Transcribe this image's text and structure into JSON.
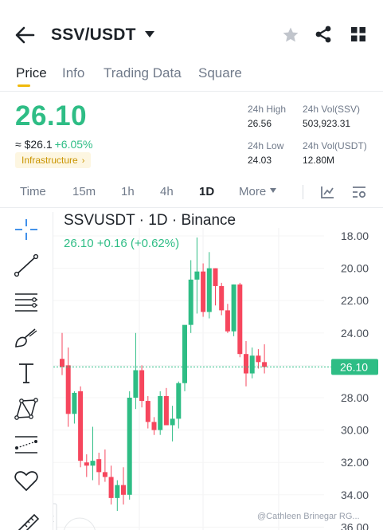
{
  "header": {
    "pair": "SSV/USDT",
    "icons": [
      "back-arrow-icon",
      "caret-down-icon",
      "star-icon",
      "share-icon",
      "grid-icon"
    ]
  },
  "tabs": [
    {
      "label": "Price",
      "active": true
    },
    {
      "label": "Info",
      "active": false
    },
    {
      "label": "Trading Data",
      "active": false
    },
    {
      "label": "Square",
      "active": false
    }
  ],
  "ticker": {
    "last_price": "26.10",
    "usd_price": "≈ $26.1",
    "change_pct": "+6.05%",
    "tag": "Infrastructure",
    "tag_chevron": "›",
    "high_label": "24h High",
    "high_value": "26.56",
    "vol_base_label": "24h Vol(SSV)",
    "vol_base_value": "503,923.31",
    "low_label": "24h Low",
    "low_value": "24.03",
    "vol_quote_label": "24h Vol(USDT)",
    "vol_quote_value": "12.80M"
  },
  "intervals": [
    {
      "label": "Time",
      "active": false
    },
    {
      "label": "15m",
      "active": false
    },
    {
      "label": "1h",
      "active": false
    },
    {
      "label": "4h",
      "active": false
    },
    {
      "label": "1D",
      "active": true
    },
    {
      "label": "More",
      "active": false
    }
  ],
  "interval_icons": [
    "indicator-chart-icon",
    "chart-settings-icon"
  ],
  "tools": [
    "crosshair-icon",
    "trend-line-icon",
    "horizontal-lines-icon",
    "brush-icon",
    "text-icon",
    "pattern-icon",
    "measure-icon",
    "heart-icon",
    "ruler-icon"
  ],
  "colors": {
    "up": "#2ebd85",
    "down": "#f6465d",
    "accent": "#f0b90b",
    "muted": "#707a8a"
  },
  "chart": {
    "title": "SSVUSDT · 1D · Binance",
    "subtitle": "26.10  +0.16 (+0.62%)",
    "price_tag": "26.10",
    "watermark": "@Cathleen Brinegar RG..."
  },
  "chart_data": {
    "type": "candlestick",
    "y_axis_ticks": [
      "18.00",
      "20.00",
      "22.00",
      "24.00",
      "26.00",
      "28.00",
      "30.00",
      "32.00",
      "34.00",
      "36.00"
    ],
    "y_inverted": true,
    "ylim": [
      17.0,
      36.5
    ],
    "last_price": 26.1,
    "candles": [
      {
        "o": 25.6,
        "h": 24.0,
        "l": 26.6,
        "c": 26.1
      },
      {
        "o": 26.0,
        "h": 24.9,
        "l": 29.8,
        "c": 29.0
      },
      {
        "o": 29.0,
        "h": 27.6,
        "l": 29.6,
        "c": 27.7
      },
      {
        "o": 27.6,
        "h": 27.3,
        "l": 32.3,
        "c": 31.9
      },
      {
        "o": 32.0,
        "h": 31.5,
        "l": 32.9,
        "c": 32.2
      },
      {
        "o": 32.2,
        "h": 29.8,
        "l": 33.1,
        "c": 31.9
      },
      {
        "o": 31.8,
        "h": 31.4,
        "l": 33.4,
        "c": 32.6
      },
      {
        "o": 32.6,
        "h": 31.2,
        "l": 33.2,
        "c": 32.9
      },
      {
        "o": 32.9,
        "h": 32.2,
        "l": 34.6,
        "c": 34.2
      },
      {
        "o": 34.2,
        "h": 33.1,
        "l": 35.0,
        "c": 33.4
      },
      {
        "o": 33.4,
        "h": 32.3,
        "l": 34.6,
        "c": 34.0
      },
      {
        "o": 34.0,
        "h": 27.6,
        "l": 34.3,
        "c": 28.0
      },
      {
        "o": 28.0,
        "h": 24.0,
        "l": 28.7,
        "c": 26.3
      },
      {
        "o": 26.3,
        "h": 26.0,
        "l": 28.6,
        "c": 28.2
      },
      {
        "o": 28.2,
        "h": 27.9,
        "l": 29.9,
        "c": 29.5
      },
      {
        "o": 29.5,
        "h": 29.2,
        "l": 30.3,
        "c": 30.0
      },
      {
        "o": 30.0,
        "h": 27.6,
        "l": 30.3,
        "c": 27.9
      },
      {
        "o": 27.9,
        "h": 27.4,
        "l": 29.6,
        "c": 29.7
      },
      {
        "o": 29.7,
        "h": 28.5,
        "l": 30.7,
        "c": 29.3
      },
      {
        "o": 29.3,
        "h": 27.0,
        "l": 29.9,
        "c": 27.1
      },
      {
        "o": 27.1,
        "h": 23.6,
        "l": 27.6,
        "c": 23.5
      },
      {
        "o": 23.5,
        "h": 19.5,
        "l": 24.0,
        "c": 20.7
      },
      {
        "o": 20.7,
        "h": 18.1,
        "l": 22.8,
        "c": 20.2
      },
      {
        "o": 20.2,
        "h": 19.7,
        "l": 23.0,
        "c": 22.7
      },
      {
        "o": 22.7,
        "h": 19.0,
        "l": 23.1,
        "c": 20.0
      },
      {
        "o": 20.0,
        "h": 20.0,
        "l": 22.3,
        "c": 21.1
      },
      {
        "o": 21.1,
        "h": 20.9,
        "l": 22.9,
        "c": 22.6
      },
      {
        "o": 22.6,
        "h": 22.2,
        "l": 24.0,
        "c": 23.9
      },
      {
        "o": 23.9,
        "h": 21.0,
        "l": 24.2,
        "c": 21.0
      },
      {
        "o": 21.0,
        "h": 20.9,
        "l": 25.5,
        "c": 25.3
      },
      {
        "o": 25.3,
        "h": 24.5,
        "l": 27.3,
        "c": 26.5
      },
      {
        "o": 26.5,
        "h": 24.9,
        "l": 26.8,
        "c": 25.4
      },
      {
        "o": 25.4,
        "h": 25.0,
        "l": 26.2,
        "c": 25.8
      },
      {
        "o": 25.8,
        "h": 24.7,
        "l": 26.5,
        "c": 26.1
      }
    ]
  }
}
